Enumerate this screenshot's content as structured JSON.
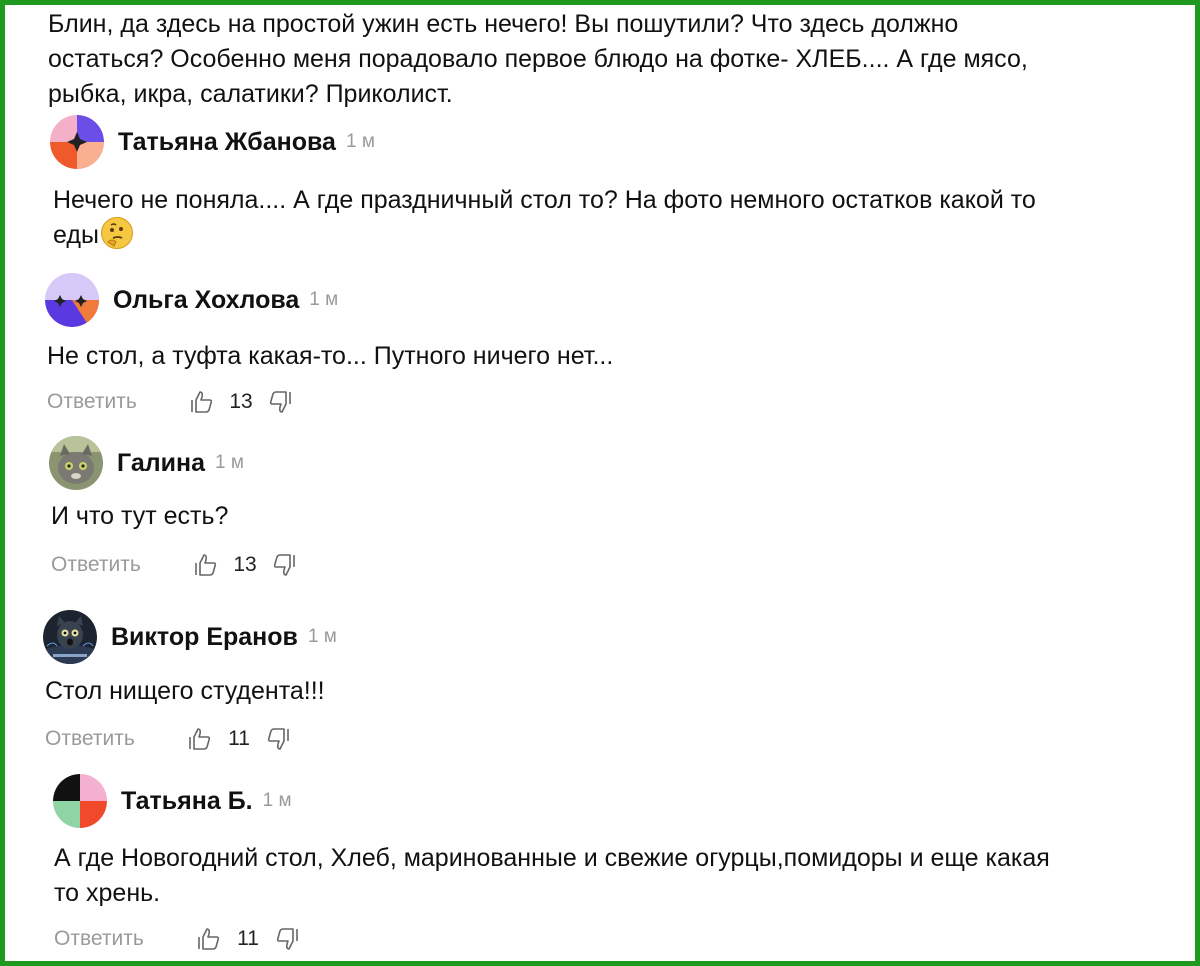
{
  "intro": {
    "lines": [
      "Блин, да здесь на простой ужин есть нечего! Вы пошутили? Что здесь должно",
      "остаться? Особенно меня порадовало первое блюдо на фотке- ХЛЕБ.... А где мясо,",
      "рыбка, икра, салатики? Приколист."
    ]
  },
  "ui": {
    "reply_label": "Ответить"
  },
  "comments": [
    {
      "author": "Татьяна Жбанова",
      "time": "1 м",
      "lines": [
        "Нечего не поняла.... А где праздничный стол то? На фото немного остатков какой то",
        "еды"
      ],
      "emoji": "thinking-face"
    },
    {
      "author": "Ольга Хохлова",
      "time": "1 м",
      "lines": [
        "Не стол, а туфта какая-то... Путного ничего нет..."
      ],
      "likes": "13"
    },
    {
      "author": "Галина",
      "time": "1 м",
      "lines": [
        "И что тут есть?"
      ],
      "likes": "13"
    },
    {
      "author": "Виктор Еранов",
      "time": "1 м",
      "lines": [
        "Стол нищего студента!!!"
      ],
      "likes": "11"
    },
    {
      "author": "Татьяна Б.",
      "time": "1 м",
      "lines": [
        "А где Новогодний стол, Хлеб, маринованные и свежие огурцы,помидоры и еще какая",
        "то хрень."
      ],
      "likes": "11"
    }
  ],
  "colors": {
    "frame": "#1f9a1f",
    "muted": "#9a9a9a"
  },
  "icons": [
    "thumbs-up-icon",
    "thumbs-down-icon",
    "thinking-face-emoji"
  ]
}
